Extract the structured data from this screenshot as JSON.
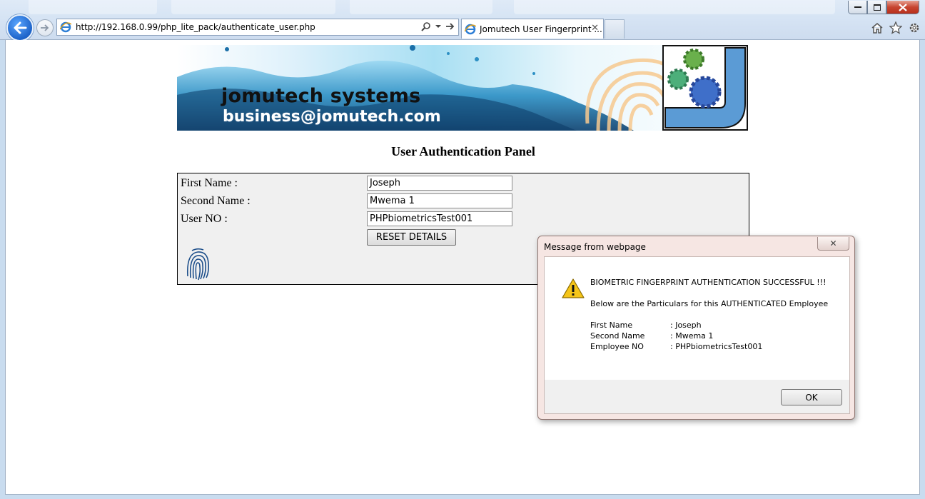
{
  "browser": {
    "url": "http://192.168.0.99/php_lite_pack/authenticate_user.php",
    "tab_title": "Jomutech User Fingerprint ...",
    "tab_close": "✕",
    "icons": [
      "back-arrow-icon",
      "forward-arrow-icon",
      "ie-logo-icon",
      "search-icon",
      "dropdown-icon",
      "refresh-icon",
      "home-icon",
      "favorites-star-icon",
      "settings-gear-icon"
    ]
  },
  "banner": {
    "brand": "jomutech systems",
    "email": "business@jomutech.com"
  },
  "page": {
    "title": "User Authentication Panel"
  },
  "form": {
    "first_name_label": "First Name :",
    "first_name_value": "Joseph",
    "second_name_label": "Second Name :",
    "second_name_value": "Mwema 1",
    "user_no_label": "User NO :",
    "user_no_value": "PHPbiometricsTest001",
    "reset_label": "RESET DETAILS"
  },
  "dialog": {
    "title": "Message from webpage",
    "close_glyph": "✕",
    "heading": "BIOMETRIC FINGERPRINT AUTHENTICATION SUCCESSFUL !!!",
    "subheading": "Below are the Particulars for this AUTHENTICATED Employee",
    "rows": [
      {
        "key": "First Name",
        "value": ": Joseph"
      },
      {
        "key": "Second Name",
        "value": ": Mwema 1"
      },
      {
        "key": "Employee NO",
        "value": ": PHPbiometricsTest001"
      }
    ],
    "ok_label": "OK"
  },
  "colors": {
    "chrome_bg": "#d6e4f4",
    "panel_bg": "#f0f0f0",
    "dialog_frame": "#f6e6e3",
    "accent_blue": "#1d63c8"
  }
}
